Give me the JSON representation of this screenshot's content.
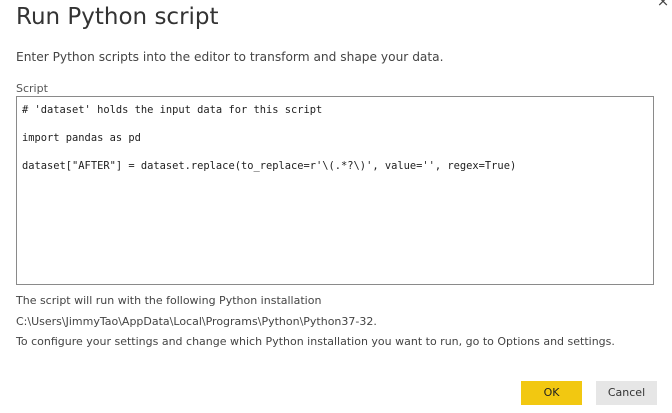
{
  "dialog": {
    "title": "Run Python script",
    "close_glyph": "×",
    "subtitle": "Enter Python scripts into the editor to transform and shape your data.",
    "script_label": "Script",
    "script_lines": [
      "# 'dataset' holds the input data for this script",
      "",
      "import pandas as pd",
      "",
      "dataset[\"AFTER\"] = dataset.replace(to_replace=r'\\(.*?\\)', value='', regex=True)"
    ],
    "info_line_1": "The script will run with the following Python installation",
    "info_path": "C:\\Users\\JimmyTao\\AppData\\Local\\Programs\\Python\\Python37-32.",
    "info_line_3": "To configure your settings and change which Python installation you want to run, go to Options and settings.",
    "ok_label": "OK",
    "cancel_label": "Cancel",
    "ok_color": "#f2c811"
  }
}
